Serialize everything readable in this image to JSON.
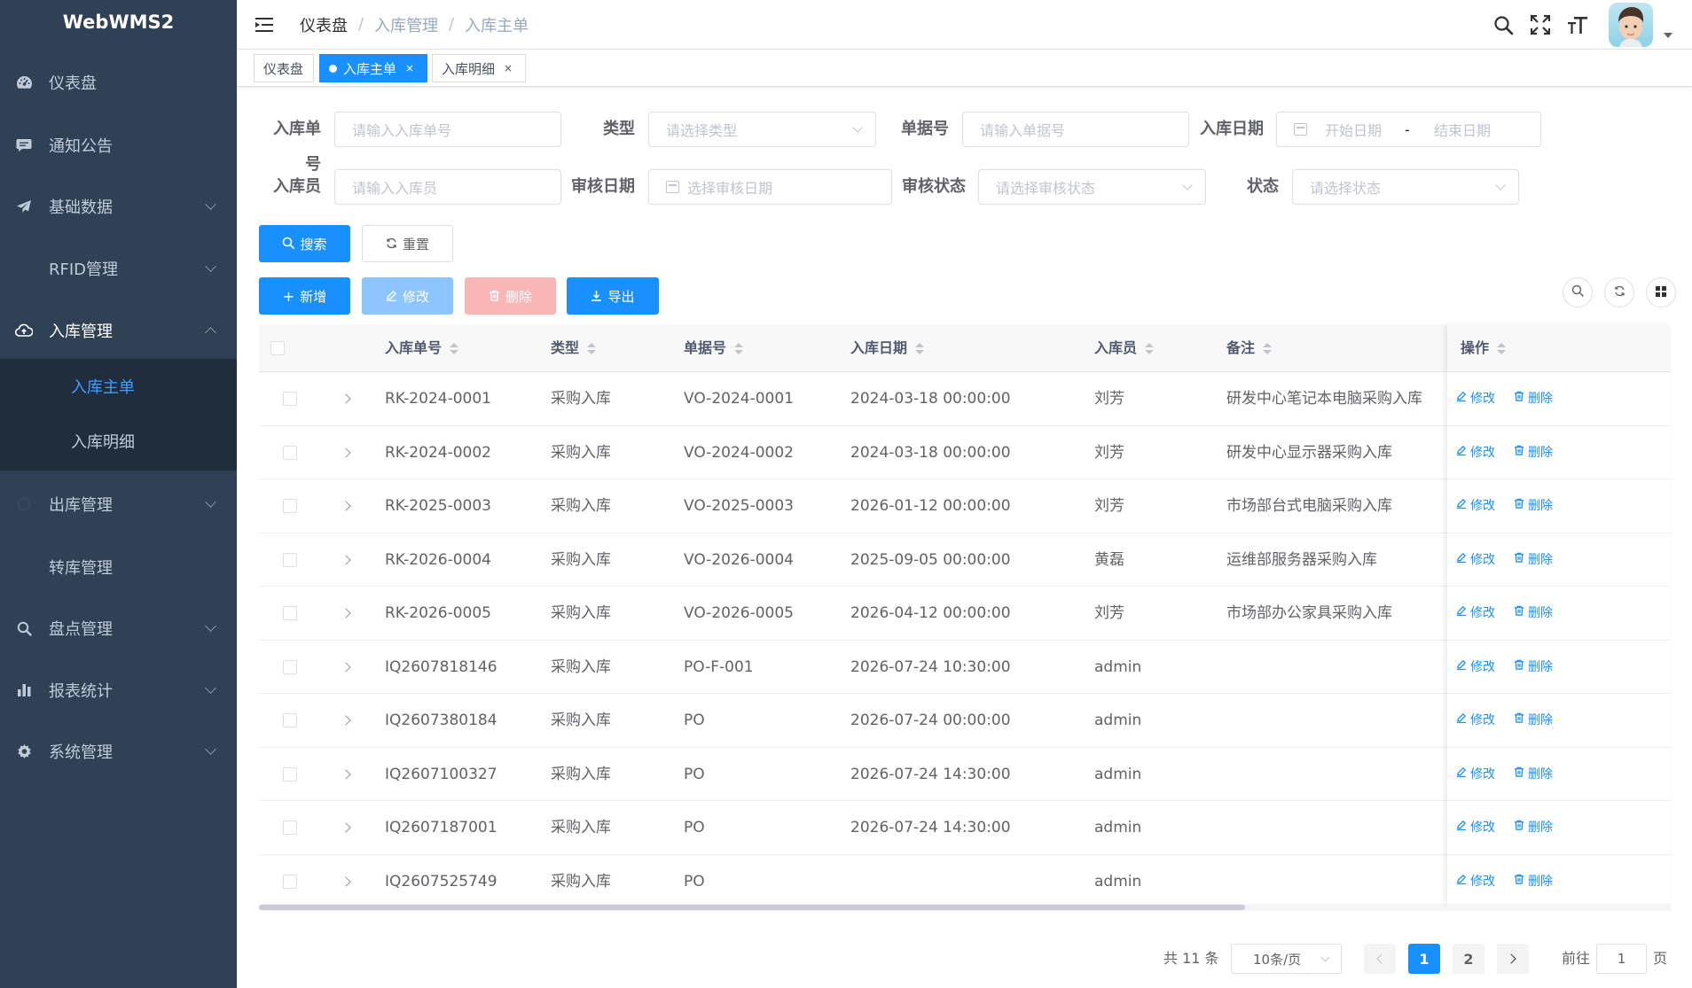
{
  "app": {
    "logo": "WebWMS2"
  },
  "sidebar": {
    "items": [
      {
        "label": "仪表盘",
        "icon": "dashboard-icon",
        "has_children": false
      },
      {
        "label": "通知公告",
        "icon": "message-icon",
        "has_children": false
      },
      {
        "label": "基础数据",
        "icon": "send-icon",
        "has_children": true
      },
      {
        "label": "RFID管理",
        "icon": "",
        "has_children": true
      },
      {
        "label": "入库管理",
        "icon": "upload-cloud-icon",
        "has_children": true,
        "expanded": true
      },
      {
        "label": "出库管理",
        "icon": "shipping-icon",
        "has_children": true
      },
      {
        "label": "转库管理",
        "icon": "",
        "has_children": false
      },
      {
        "label": "盘点管理",
        "icon": "search-icon",
        "has_children": true
      },
      {
        "label": "报表统计",
        "icon": "chart-icon",
        "has_children": true
      },
      {
        "label": "系统管理",
        "icon": "gear-icon",
        "has_children": true
      }
    ],
    "submenu": [
      {
        "label": "入库主单",
        "active": true
      },
      {
        "label": "入库明细",
        "active": false
      }
    ]
  },
  "header": {
    "breadcrumb": [
      "仪表盘",
      "入库管理",
      "入库主单"
    ]
  },
  "tags": [
    {
      "label": "仪表盘",
      "active": false,
      "closable": false
    },
    {
      "label": "入库主单",
      "active": true,
      "closable": true,
      "close": "×"
    },
    {
      "label": "入库明细",
      "active": false,
      "closable": true,
      "close": "×"
    }
  ],
  "filters": {
    "inbound_no": {
      "label": "入库单号",
      "placeholder": "请输入入库单号"
    },
    "type": {
      "label": "类型",
      "placeholder": "请选择类型"
    },
    "doc_no": {
      "label": "单据号",
      "placeholder": "请输入单据号"
    },
    "inbound_date": {
      "label": "入库日期",
      "start_placeholder": "开始日期",
      "separator": "-",
      "end_placeholder": "结束日期"
    },
    "operator": {
      "label": "入库员",
      "placeholder": "请输入入库员"
    },
    "audit_date": {
      "label": "审核日期",
      "placeholder": "选择审核日期"
    },
    "audit_status": {
      "label": "审核状态",
      "placeholder": "请选择审核状态"
    },
    "status": {
      "label": "状态",
      "placeholder": "请选择状态"
    }
  },
  "buttons": {
    "search": "搜索",
    "reset": "重置",
    "add": "新增",
    "edit": "修改",
    "delete": "删除",
    "export": "导出"
  },
  "table": {
    "columns": [
      "入库单号",
      "类型",
      "单据号",
      "入库日期",
      "入库员",
      "备注",
      "操作"
    ],
    "row_actions": {
      "edit": "修改",
      "delete": "删除"
    },
    "rows": [
      {
        "no": "RK-2024-0001",
        "type": "采购入库",
        "doc": "VO-2024-0001",
        "date": "2024-03-18 00:00:00",
        "operator": "刘芳",
        "remark": "研发中心笔记本电脑采购入库"
      },
      {
        "no": "RK-2024-0002",
        "type": "采购入库",
        "doc": "VO-2024-0002",
        "date": "2024-03-18 00:00:00",
        "operator": "刘芳",
        "remark": "研发中心显示器采购入库"
      },
      {
        "no": "RK-2025-0003",
        "type": "采购入库",
        "doc": "VO-2025-0003",
        "date": "2026-01-12 00:00:00",
        "operator": "刘芳",
        "remark": "市场部台式电脑采购入库"
      },
      {
        "no": "RK-2026-0004",
        "type": "采购入库",
        "doc": "VO-2026-0004",
        "date": "2025-09-05 00:00:00",
        "operator": "黄磊",
        "remark": "运维部服务器采购入库"
      },
      {
        "no": "RK-2026-0005",
        "type": "采购入库",
        "doc": "VO-2026-0005",
        "date": "2026-04-12 00:00:00",
        "operator": "刘芳",
        "remark": "市场部办公家具采购入库"
      },
      {
        "no": "IQ2607818146",
        "type": "采购入库",
        "doc": "PO-F-001",
        "date": "2026-07-24 10:30:00",
        "operator": "admin",
        "remark": ""
      },
      {
        "no": "IQ2607380184",
        "type": "采购入库",
        "doc": "PO",
        "date": "2026-07-24 00:00:00",
        "operator": "admin",
        "remark": ""
      },
      {
        "no": "IQ2607100327",
        "type": "采购入库",
        "doc": "PO",
        "date": "2026-07-24 14:30:00",
        "operator": "admin",
        "remark": ""
      },
      {
        "no": "IQ2607187001",
        "type": "采购入库",
        "doc": "PO",
        "date": "2026-07-24 14:30:00",
        "operator": "admin",
        "remark": ""
      },
      {
        "no": "IQ2607525749",
        "type": "采购入库",
        "doc": "PO",
        "date": "",
        "operator": "admin",
        "remark": ""
      }
    ]
  },
  "pagination": {
    "total_text": "共 11 条",
    "page_size": "10条/页",
    "pages": [
      "1",
      "2"
    ],
    "current_page": "1",
    "goto_label": "前往",
    "goto_value": "1",
    "page_suffix": "页"
  },
  "colors": {
    "sidebar_bg": "#304156",
    "submenu_bg": "#1f2d3d",
    "primary": "#1890ff",
    "active_menu_text": "#409eff"
  }
}
